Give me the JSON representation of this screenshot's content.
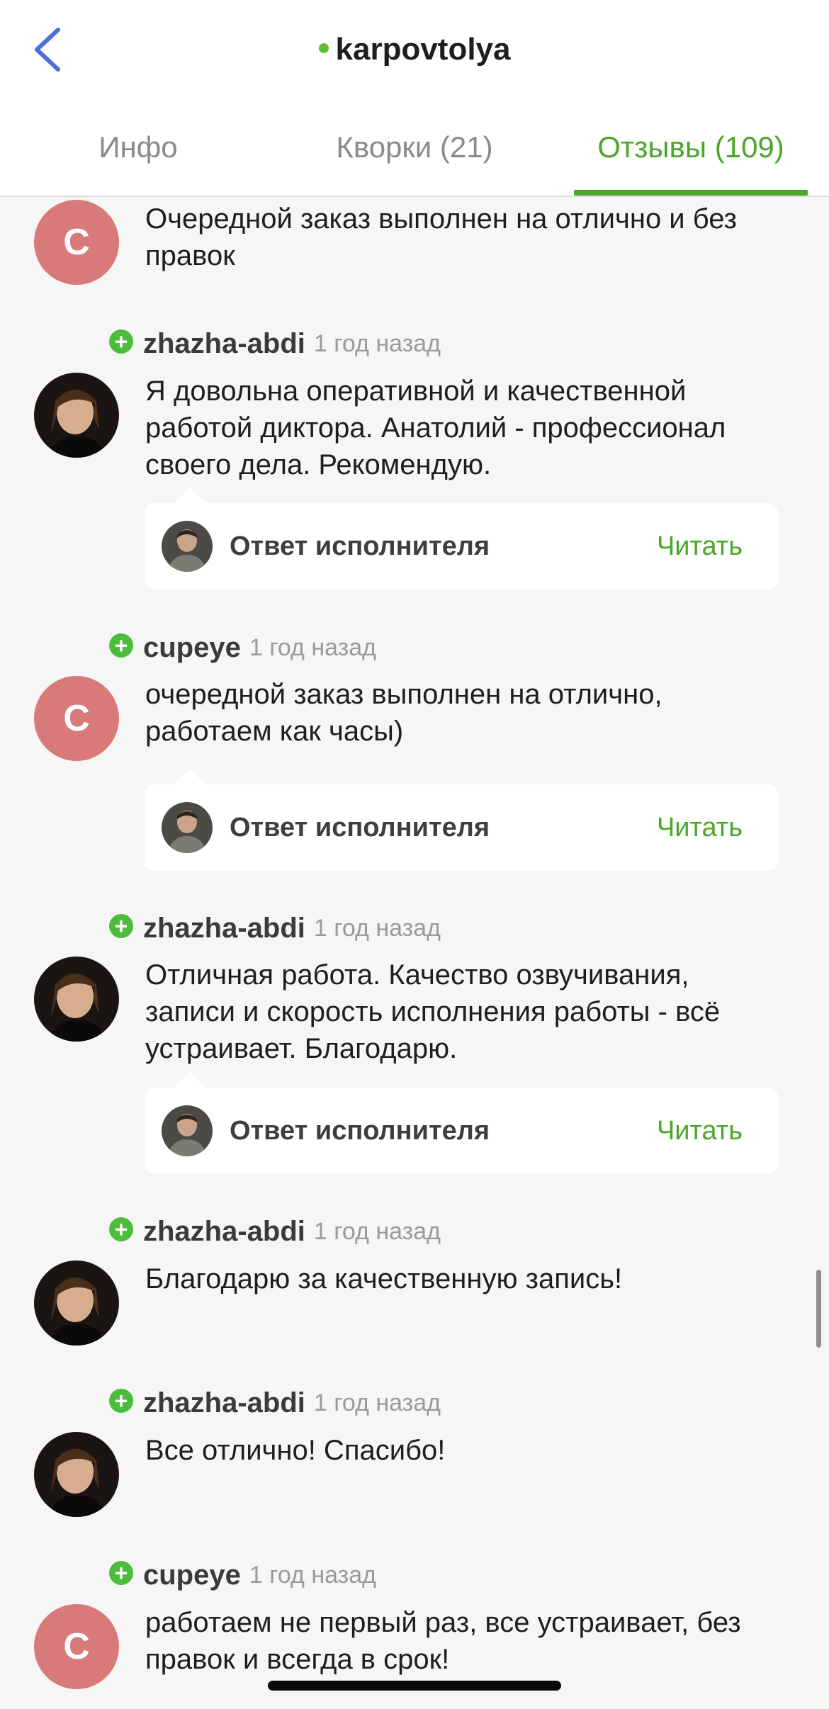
{
  "header": {
    "title": "karpovtolya",
    "tabs": [
      {
        "label": "Инфо",
        "active": false
      },
      {
        "label": "Кворки (21)",
        "active": false
      },
      {
        "label": "Отзывы (109)",
        "active": true
      }
    ]
  },
  "colors": {
    "accent": "#4ca62b",
    "online": "#5bbf3a",
    "letter_avatar": "#d87a79"
  },
  "reviews": [
    {
      "user": "",
      "time": "",
      "avatar": "letter",
      "avatar_letter": "C",
      "text": "Очередной заказ выполнен на отлично и без правок",
      "has_answer": false
    },
    {
      "user": "zhazha-abdi",
      "time": "1 год назад",
      "avatar": "photo-woman",
      "avatar_letter": "",
      "text": "Я довольна оперативной и качественной работой диктора. Анатолий - профессионал своего дела. Рекомендую.",
      "has_answer": true
    },
    {
      "user": "cupeye",
      "time": "1 год назад",
      "avatar": "letter",
      "avatar_letter": "C",
      "text": "очередной заказ выполнен на отлично, работаем как часы)",
      "has_answer": true
    },
    {
      "user": "zhazha-abdi",
      "time": "1 год назад",
      "avatar": "photo-woman",
      "avatar_letter": "",
      "text": "Отличная работа. Качество озвучивания, записи и скорость исполнения работы - всё устраивает. Благодарю.",
      "has_answer": true
    },
    {
      "user": "zhazha-abdi",
      "time": "1 год назад",
      "avatar": "photo-woman",
      "avatar_letter": "",
      "text": "Благодарю за качественную запись!",
      "has_answer": false
    },
    {
      "user": "zhazha-abdi",
      "time": "1 год назад",
      "avatar": "photo-woman",
      "avatar_letter": "",
      "text": "Все отлично! Спасибо!",
      "has_answer": false
    },
    {
      "user": "cupeye",
      "time": "1 год назад",
      "avatar": "letter",
      "avatar_letter": "C",
      "text": "работаем не первый раз, все устраивает, без правок и всегда в срок!",
      "has_answer": false
    }
  ],
  "answer": {
    "label": "Ответ исполнителя",
    "read_label": "Читать"
  },
  "icons": {
    "back": "chevron-left-icon",
    "plus": "plus-badge-icon"
  }
}
